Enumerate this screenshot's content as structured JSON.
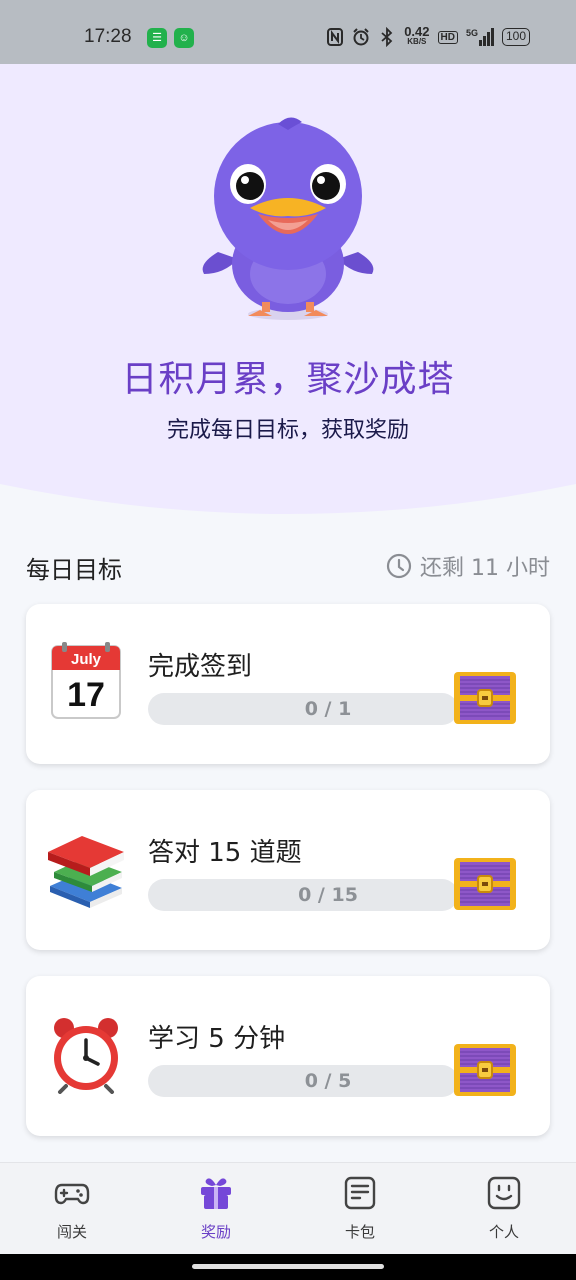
{
  "status_bar": {
    "time": "17:28",
    "network_speed_value": "0.42",
    "network_speed_unit": "KB/S",
    "hd_label": "HD",
    "signal_label": "5G",
    "battery": "100"
  },
  "hero": {
    "title": "日积月累，聚沙成塔",
    "subtitle": "完成每日目标，获取奖励",
    "background_color": "#efeaff",
    "accent_color": "#6a3fc6"
  },
  "daily_goals": {
    "section_title": "每日目标",
    "remaining_text": "还剩 11 小时",
    "tasks": [
      {
        "icon": "calendar-icon",
        "calendar_month": "July",
        "calendar_day": "17",
        "title": "完成签到",
        "progress_text": "0 / 1",
        "progress_fraction": 0
      },
      {
        "icon": "books-icon",
        "title": "答对 15 道题",
        "progress_text": "0 / 15",
        "progress_fraction": 0
      },
      {
        "icon": "alarm-clock-icon",
        "title": "学习 5 分钟",
        "progress_text": "0 / 5",
        "progress_fraction": 0
      }
    ]
  },
  "bottom_nav": {
    "items": [
      {
        "label": "闯关",
        "icon": "gamepad-icon",
        "active": false
      },
      {
        "label": "奖励",
        "icon": "gift-icon",
        "active": true
      },
      {
        "label": "卡包",
        "icon": "card-pack-icon",
        "active": false
      },
      {
        "label": "个人",
        "icon": "smiley-icon",
        "active": false
      }
    ]
  }
}
